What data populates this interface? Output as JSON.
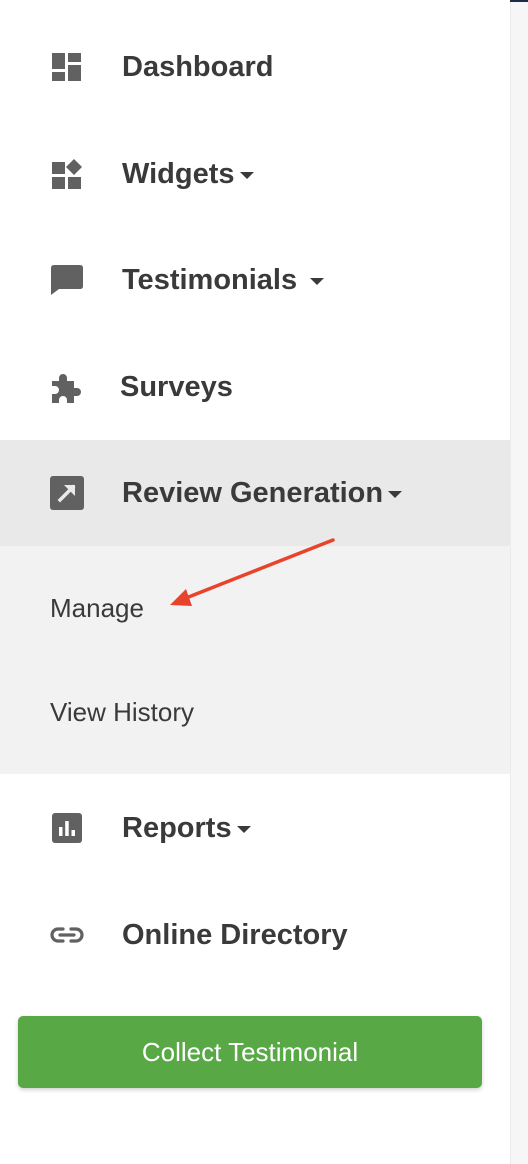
{
  "sidebar": {
    "items": [
      {
        "label": "Dashboard",
        "icon": "dashboard-icon"
      },
      {
        "label": "Widgets",
        "icon": "widgets-icon",
        "has_dropdown": true
      },
      {
        "label": "Testimonials",
        "icon": "chat-bubble-icon",
        "has_dropdown": true
      },
      {
        "label": "Surveys",
        "icon": "puzzle-icon"
      },
      {
        "label": "Review Generation",
        "icon": "external-link-icon",
        "has_dropdown": true,
        "active": true
      },
      {
        "label": "Reports",
        "icon": "bar-chart-icon",
        "has_dropdown": true
      },
      {
        "label": "Online Directory",
        "icon": "link-icon"
      }
    ],
    "review_generation_submenu": [
      {
        "label": "Manage"
      },
      {
        "label": "View History"
      }
    ],
    "collect_button": {
      "label": "Collect Testimonial"
    }
  },
  "colors": {
    "icon": "#616161",
    "text": "#3a3a3a",
    "active_bg": "#e9e9e9",
    "submenu_bg": "#f2f2f2",
    "button_green": "#58a946",
    "annotation_arrow": "#e8432b"
  }
}
